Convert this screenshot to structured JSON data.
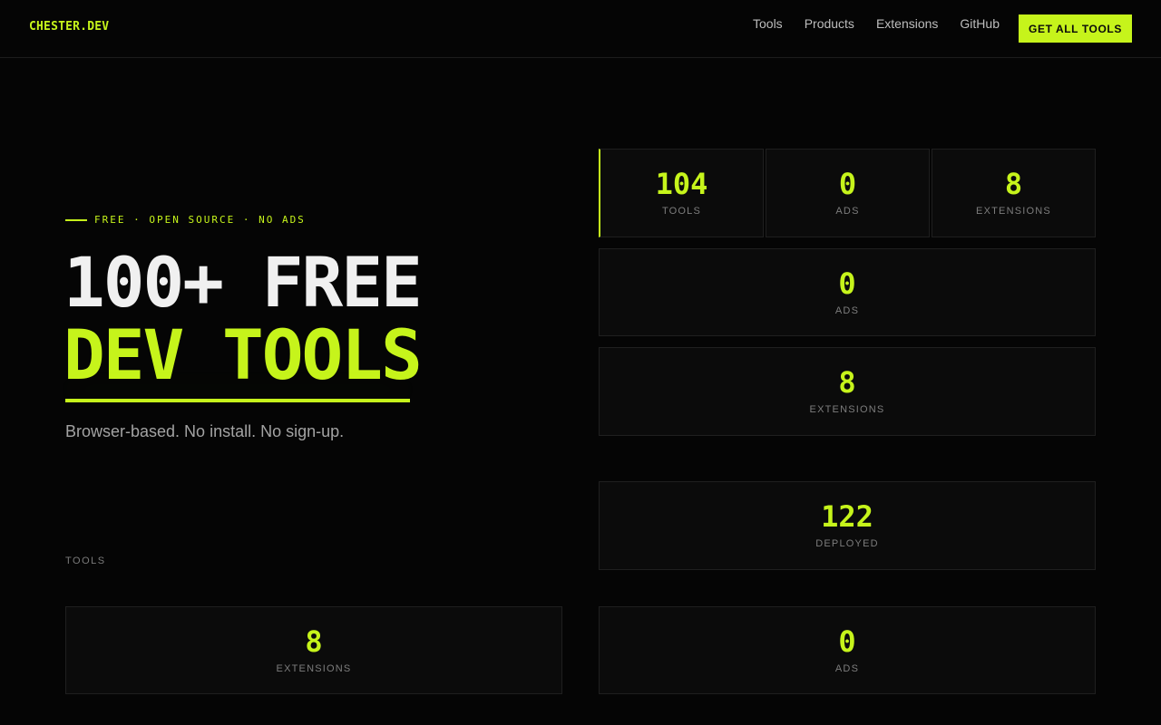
{
  "header": {
    "logo": "CHESTER.DEV",
    "nav": [
      "Tools",
      "Products",
      "Extensions",
      "GitHub"
    ],
    "cta": "GET ALL TOOLS"
  },
  "hero": {
    "eyebrow": "FREE · OPEN SOURCE · NO ADS",
    "headline_line1": "100+ FREE",
    "headline_line2": "DEV TOOLS",
    "subtitle": "Browser-based. No install. No sign-up.",
    "section_label": "TOOLS"
  },
  "stats": [
    {
      "value": "104",
      "label": "TOOLS"
    },
    {
      "value": "0",
      "label": "ADS"
    },
    {
      "value": "8",
      "label": "EXTENSIONS"
    },
    {
      "value": "0",
      "label": "ADS"
    },
    {
      "value": "8",
      "label": "EXTENSIONS"
    },
    {
      "value": "122",
      "label": "DEPLOYED"
    },
    {
      "value": "8",
      "label": "EXTENSIONS"
    },
    {
      "value": "0",
      "label": "ADS"
    }
  ],
  "colors": {
    "accent": "#c6f41b",
    "background": "#050505",
    "card": "#0b0b0b"
  }
}
